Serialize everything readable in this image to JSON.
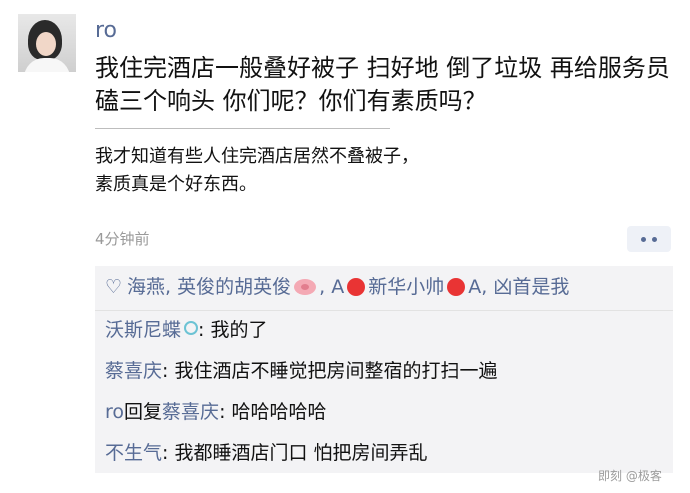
{
  "post": {
    "username": "ro",
    "text": "我住完酒店一般叠好被子 扫好地 倒了垃圾 再给服务员磕三个响头 你们呢？你们有素质吗？",
    "quote": "我才知道有些人住完酒店居然不叠被子，素质真是个好东西。",
    "time": "4分钟前"
  },
  "likes": {
    "names": [
      "海燕",
      "英俊的胡英俊",
      "A",
      "新华小帅",
      "A",
      "凶首是我"
    ]
  },
  "comments": [
    {
      "user": "沃斯尼蝶",
      "text": "我的了"
    },
    {
      "user": "蔡喜庆",
      "text": "我住酒店不睡觉把房间整宿的打扫一遍"
    },
    {
      "user": "ro",
      "reply_word": "回复",
      "reply_to": "蔡喜庆",
      "text": "哈哈哈哈哈"
    },
    {
      "user": "不生气",
      "text": "我都睡酒店门口 怕把房间弄乱"
    }
  ],
  "watermark": "即刻 @极客"
}
